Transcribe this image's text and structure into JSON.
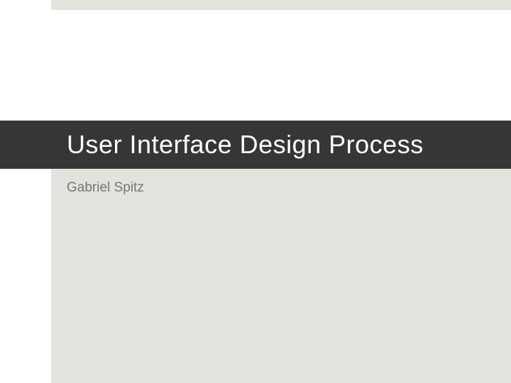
{
  "slide": {
    "title": "User Interface Design Process",
    "author": "Gabriel Spitz"
  }
}
